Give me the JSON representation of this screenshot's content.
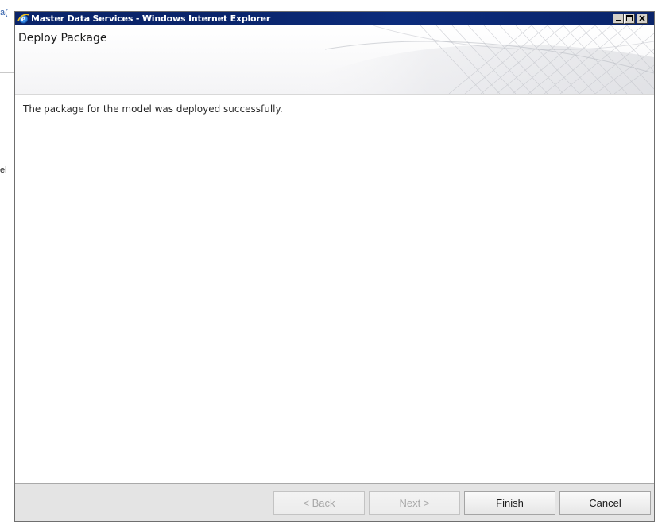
{
  "background_app": {
    "fragment_top": "a(",
    "fragment_mid": "el"
  },
  "window": {
    "title": "Master Data Services - Windows Internet Explorer",
    "icon": "ie-icon",
    "controls": {
      "minimize_icon": "minimize-icon",
      "maximize_icon": "maximize-icon",
      "close_icon": "close-icon"
    }
  },
  "header": {
    "title": "Deploy Package"
  },
  "content": {
    "message": "The package for the model was deployed successfully."
  },
  "footer": {
    "buttons": [
      {
        "label": "< Back",
        "enabled": false
      },
      {
        "label": "Next >",
        "enabled": false
      },
      {
        "label": "Finish",
        "enabled": true
      },
      {
        "label": "Cancel",
        "enabled": true
      }
    ]
  },
  "colors": {
    "titlebar": "#0a246a",
    "titlebar_text": "#ffffff",
    "footer_bg": "#e4e4e4",
    "disabled_text": "#a8a8a8"
  }
}
